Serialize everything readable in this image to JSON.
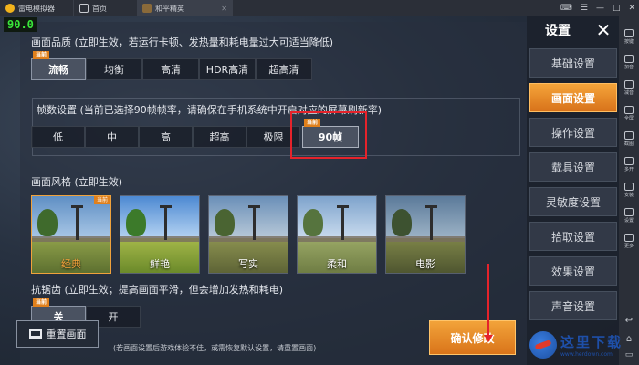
{
  "emulator": {
    "app_title": "雷电模拟器",
    "tabs": [
      {
        "label": "首页"
      },
      {
        "label": "和平精英"
      }
    ]
  },
  "fps_counter": "90.0",
  "quality": {
    "title": "画面品质 (立即生效，若运行卡顿、发热量和耗电量过大可适当降低)",
    "current_badge": "当前",
    "options": [
      "流畅",
      "均衡",
      "高清",
      "HDR高清",
      "超高清"
    ],
    "selected": "流畅"
  },
  "framerate": {
    "title": "帧数设置 (当前已选择90帧帧率，请确保在手机系统中开启对应的屏幕刷新率)",
    "current_badge": "当前",
    "options": [
      "低",
      "中",
      "高",
      "超高",
      "极限",
      "90帧"
    ],
    "selected": "90帧"
  },
  "style": {
    "title": "画面风格 (立即生效)",
    "current_badge": "当前",
    "options": [
      "经典",
      "鲜艳",
      "写实",
      "柔和",
      "电影"
    ],
    "selected": "经典"
  },
  "antialias": {
    "title": "抗锯齿 (立即生效；提高画面平滑，但会增加发热和耗电)",
    "current_badge": "当前",
    "options": [
      "关",
      "开"
    ],
    "selected": "关"
  },
  "bottom": {
    "reset_label": "重置画面",
    "note": "(若画面设置后游戏体验不佳，或需恢复默认设置，请重置画面)",
    "confirm_label": "确认修改"
  },
  "menu": {
    "title": "设置",
    "items": [
      "基础设置",
      "画面设置",
      "操作设置",
      "载具设置",
      "灵敏度设置",
      "拾取设置",
      "效果设置",
      "声音设置"
    ],
    "active": "画面设置"
  },
  "toolbar": {
    "items": [
      "按键",
      "加音",
      "减音",
      "全屏",
      "截图",
      "多开",
      "安装",
      "设置",
      "更多"
    ]
  },
  "watermark": {
    "name": "这里下载",
    "url": "www.herdown.com"
  },
  "colors": {
    "accent_orange": "#e0801c",
    "annotation_red": "#e5232b",
    "fps_green": "#39e63a"
  }
}
